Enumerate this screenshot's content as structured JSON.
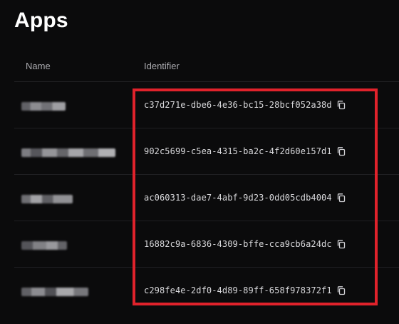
{
  "page": {
    "title": "Apps"
  },
  "table": {
    "columns": {
      "name": "Name",
      "identifier": "Identifier"
    },
    "rows": [
      {
        "name": "",
        "identifier": "c37d271e-dbe6-4e36-bc15-28bcf052a38d"
      },
      {
        "name": "",
        "identifier": "902c5699-c5ea-4315-ba2c-4f2d60e157d1"
      },
      {
        "name": "",
        "identifier": "ac060313-dae7-4abf-9d23-0dd05cdb4004"
      },
      {
        "name": "",
        "identifier": "16882c9a-6836-4309-bffe-cca9cb6a24dc"
      },
      {
        "name": "",
        "identifier": "c298fe4e-2df0-4d89-89ff-658f978372f1"
      }
    ]
  },
  "icons": {
    "copy": "copy-icon"
  },
  "colors": {
    "highlight": "#e0222b",
    "background": "#0b0b0c"
  }
}
